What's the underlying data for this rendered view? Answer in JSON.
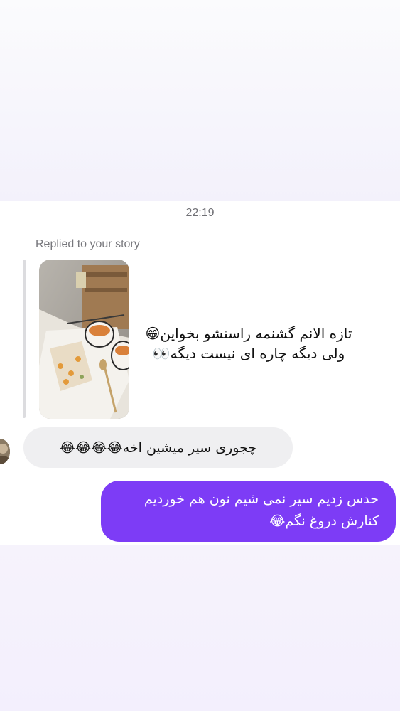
{
  "thread": {
    "timestamp": "22:19",
    "replied_label": "Replied to your story"
  },
  "story_reply": {
    "thumbnail_icon": "story-photo-icon",
    "caption_line1": "تازه الانم گشنمه راستشو بخواین😁",
    "caption_line2": "ولی دیگه چاره ای نیست دیگه👀"
  },
  "incoming": {
    "avatar_icon": "avatar-icon",
    "text": "چجوری سیر میشین اخه😂😂😂😂"
  },
  "outgoing": {
    "line1": "حدس زدیم سیر نمی شیم نون هم خوردیم",
    "line2": "کنارش دروغ نگم😂"
  },
  "colors": {
    "outgoing_bubble": "#7d3cf6",
    "incoming_bubble": "#efeff1",
    "background_tint": "#f3effd"
  }
}
